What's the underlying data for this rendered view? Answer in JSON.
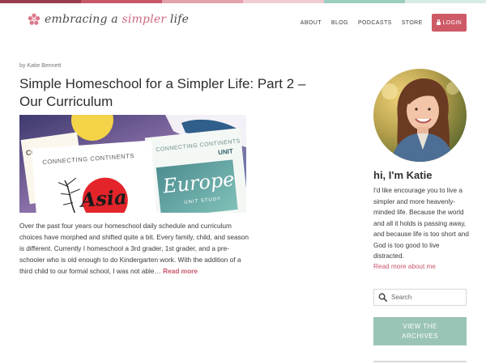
{
  "colors": {
    "stripe": [
      "#9a3c50",
      "#c7576a",
      "#e3a2ac",
      "#f0cbcf",
      "#9ccdbf",
      "#d8ebe5"
    ],
    "accent": "#cf5a67",
    "link": "#c9556a",
    "archives_button": "#99c4b6"
  },
  "header": {
    "logo": {
      "icon": "flower-icon",
      "text_main": "embracing a ",
      "text_accent": "simpler",
      "text_end": " life"
    },
    "nav": [
      "ABOUT",
      "BLOG",
      "PODCASTS",
      "STORE"
    ],
    "login": {
      "icon": "lock-icon",
      "label": "LOGIN"
    }
  },
  "post": {
    "author": "by Katie Bennett",
    "title": "Simple Homeschool for a Simpler Life: Part 2 – Our Curriculum",
    "image": {
      "left_card_heading": "CONNECTING CONTINENTS",
      "left_card_title": "Asia",
      "right_card_heading": "CONNECTING CONTINENTS",
      "right_card_title": "Europe",
      "right_card_subtitle": "UNIT STUDY",
      "back_card_fragment": "CON",
      "unit_fragment": "UNIT"
    },
    "excerpt": "Over the past four years our homeschool daily schedule and curriculum choices have morphed and shifted quite a bit. Every family, child, and season is different. Currently I homeschool a 3rd grader, 1st grader, and a pre-schooler who is old enough to do Kindergarten work. With the addition of a third child to our formal school, I was not able… ",
    "read_more": "Read more"
  },
  "sidebar": {
    "greeting": "hi, I'm Katie",
    "bio": "I'd like encourage you to live a simpler and more heavenly-minded life. Because the world and all it holds is passing away, and because life is too short and God is too good to live distracted.",
    "about_link": "Read more about me",
    "search": {
      "icon": "search-icon",
      "placeholder": "Search"
    },
    "archives_button": {
      "line1": "VIEW THE",
      "line2": "ARCHIVES"
    }
  }
}
